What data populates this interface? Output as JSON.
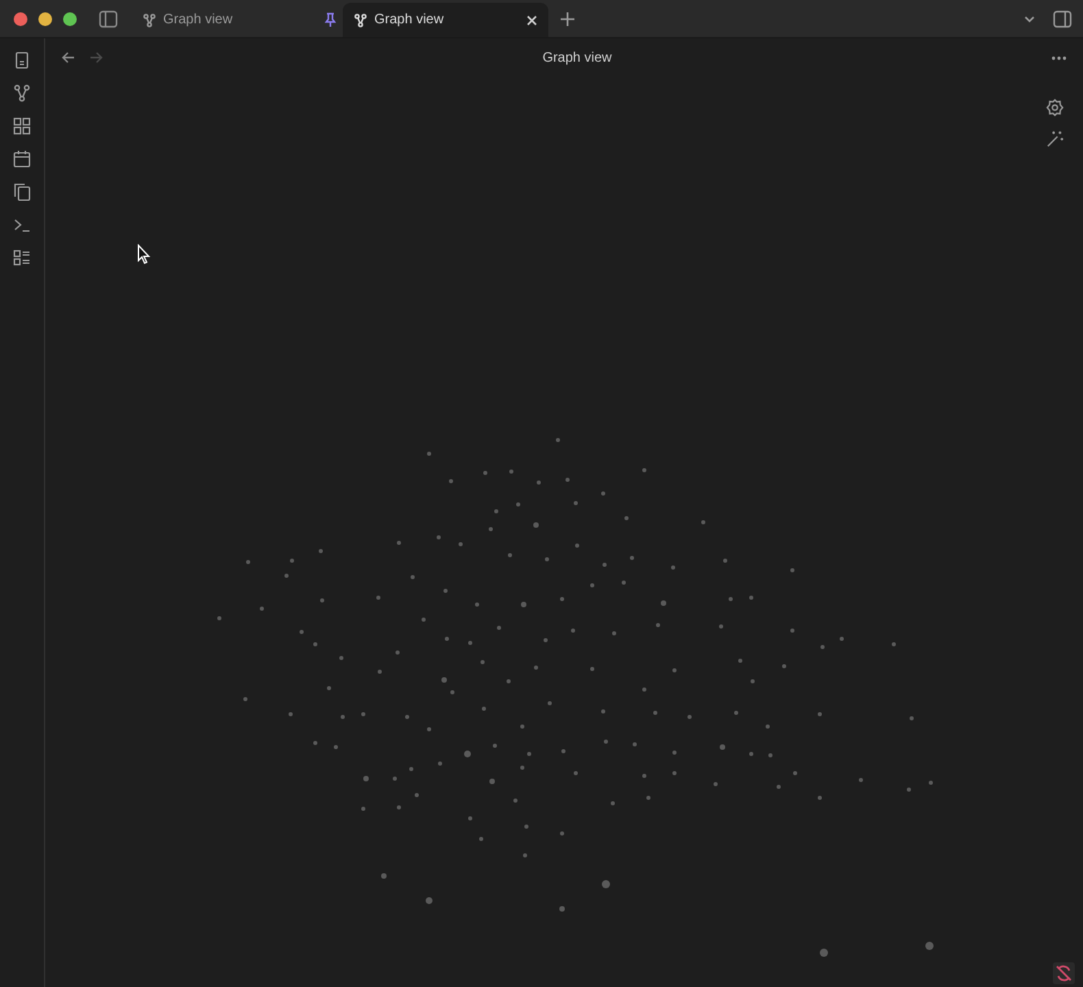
{
  "tabs": [
    {
      "label": "Graph view",
      "selected": false,
      "pinned": true
    },
    {
      "label": "Graph view",
      "selected": true,
      "pinned": false
    }
  ],
  "ribbon": [
    {
      "kind": "file"
    },
    {
      "kind": "graph"
    },
    {
      "kind": "grid"
    },
    {
      "kind": "calendar"
    },
    {
      "kind": "copy"
    },
    {
      "kind": "terminal"
    },
    {
      "kind": "list"
    }
  ],
  "view": {
    "title": "Graph view"
  }
}
